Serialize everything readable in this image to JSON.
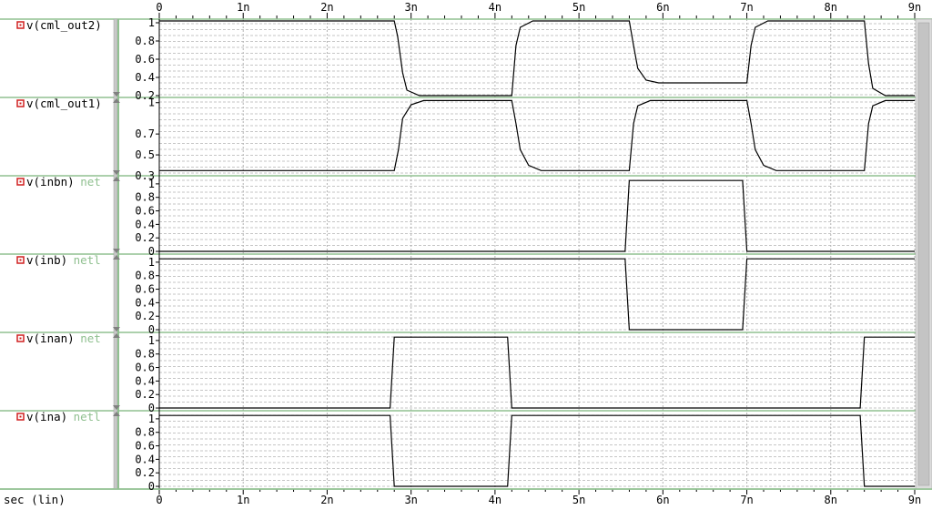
{
  "x_axis": {
    "label": "sec (lin)",
    "ticks": [
      "0",
      "1n",
      "2n",
      "3n",
      "4n",
      "5n",
      "6n",
      "7n",
      "8n",
      "9n"
    ],
    "range": [
      0,
      9
    ]
  },
  "colors": {
    "frame": "#90c090",
    "grid": "#b4b4b4",
    "trace": "#000000",
    "marker": "#d02020",
    "net_text": "#90c090",
    "background": "#ffffff"
  },
  "panels": [
    {
      "name": "v(cml_out2)",
      "extra": "",
      "ticks": [
        "1",
        "0.8",
        "0.6",
        "0.4",
        "0.2"
      ]
    },
    {
      "name": "v(cml_out1)",
      "extra": "",
      "ticks": [
        "1",
        "0.7",
        "0.5",
        "0.3"
      ]
    },
    {
      "name": "v(inbn)",
      "extra": "net",
      "ticks": [
        "1",
        "0.8",
        "0.6",
        "0.4",
        "0.2",
        "0"
      ]
    },
    {
      "name": "v(inb)",
      "extra": "netl",
      "ticks": [
        "1",
        "0.8",
        "0.6",
        "0.4",
        "0.2",
        "0"
      ]
    },
    {
      "name": "v(inan)",
      "extra": "net",
      "ticks": [
        "1",
        "0.8",
        "0.6",
        "0.4",
        "0.2",
        "0"
      ]
    },
    {
      "name": "v(ina)",
      "extra": "netl",
      "ticks": [
        "1",
        "0.8",
        "0.6",
        "0.4",
        "0.2",
        "0"
      ]
    }
  ],
  "chart_data": [
    {
      "type": "line",
      "title": "v(cml_out2)",
      "xlabel": "sec (lin)",
      "ylim": [
        0.18,
        1.04
      ],
      "yticks": [
        1,
        0.8,
        0.6,
        0.4,
        0.2
      ],
      "series": [
        {
          "name": "v(cml_out2)",
          "x": [
            0,
            2.8,
            2.84,
            2.9,
            2.95,
            3.1,
            4.2,
            4.25,
            4.3,
            4.45,
            5.6,
            5.65,
            5.7,
            5.8,
            5.95,
            7.0,
            7.05,
            7.1,
            7.25,
            8.4,
            8.45,
            8.5,
            8.65,
            9.0
          ],
          "y": [
            1.02,
            1.02,
            0.85,
            0.45,
            0.26,
            0.2,
            0.2,
            0.75,
            0.95,
            1.02,
            1.02,
            0.75,
            0.5,
            0.37,
            0.34,
            0.34,
            0.75,
            0.95,
            1.02,
            1.02,
            0.55,
            0.28,
            0.2,
            0.2
          ]
        }
      ]
    },
    {
      "type": "line",
      "title": "v(cml_out1)",
      "xlabel": "sec (lin)",
      "ylim": [
        0.3,
        1.05
      ],
      "yticks": [
        1,
        0.7,
        0.5,
        0.3
      ],
      "series": [
        {
          "name": "v(cml_out1)",
          "x": [
            0,
            2.8,
            2.85,
            2.9,
            3.0,
            3.15,
            4.2,
            4.25,
            4.3,
            4.4,
            4.55,
            5.6,
            5.65,
            5.7,
            5.85,
            7.0,
            7.05,
            7.1,
            7.2,
            7.35,
            8.4,
            8.45,
            8.5,
            8.65,
            9.0
          ],
          "y": [
            0.35,
            0.35,
            0.55,
            0.85,
            0.98,
            1.02,
            1.02,
            0.8,
            0.55,
            0.4,
            0.35,
            0.35,
            0.8,
            0.97,
            1.02,
            1.02,
            0.8,
            0.55,
            0.4,
            0.35,
            0.35,
            0.8,
            0.97,
            1.02,
            1.02
          ]
        }
      ]
    },
    {
      "type": "line",
      "title": "v(inbn)",
      "xlabel": "sec (lin)",
      "ylim": [
        -0.04,
        1.12
      ],
      "yticks": [
        1,
        0.8,
        0.6,
        0.4,
        0.2,
        0
      ],
      "series": [
        {
          "name": "v(inbn)",
          "x": [
            0,
            5.55,
            5.6,
            6.95,
            7.0,
            9.0
          ],
          "y": [
            0,
            0,
            1.05,
            1.05,
            0,
            0
          ]
        }
      ]
    },
    {
      "type": "line",
      "title": "v(inb)",
      "xlabel": "sec (lin)",
      "ylim": [
        -0.04,
        1.12
      ],
      "yticks": [
        1,
        0.8,
        0.6,
        0.4,
        0.2,
        0
      ],
      "series": [
        {
          "name": "v(inb)",
          "x": [
            0,
            5.55,
            5.6,
            6.95,
            7.0,
            9.0
          ],
          "y": [
            1.05,
            1.05,
            0,
            0,
            1.05,
            1.05
          ]
        }
      ]
    },
    {
      "type": "line",
      "title": "v(inan)",
      "xlabel": "sec (lin)",
      "ylim": [
        -0.04,
        1.12
      ],
      "yticks": [
        1,
        0.8,
        0.6,
        0.4,
        0.2,
        0
      ],
      "series": [
        {
          "name": "v(inan)",
          "x": [
            0,
            2.75,
            2.8,
            4.15,
            4.2,
            8.35,
            8.4,
            9.0
          ],
          "y": [
            0,
            0,
            1.05,
            1.05,
            0,
            0,
            1.05,
            1.05
          ]
        }
      ]
    },
    {
      "type": "line",
      "title": "v(ina)",
      "xlabel": "sec (lin)",
      "ylim": [
        -0.04,
        1.12
      ],
      "yticks": [
        1,
        0.8,
        0.6,
        0.4,
        0.2,
        0
      ],
      "series": [
        {
          "name": "v(ina)",
          "x": [
            0,
            2.75,
            2.8,
            4.15,
            4.2,
            8.35,
            8.4,
            9.0
          ],
          "y": [
            1.05,
            1.05,
            0,
            0,
            1.05,
            1.05,
            0,
            0
          ]
        }
      ]
    }
  ]
}
